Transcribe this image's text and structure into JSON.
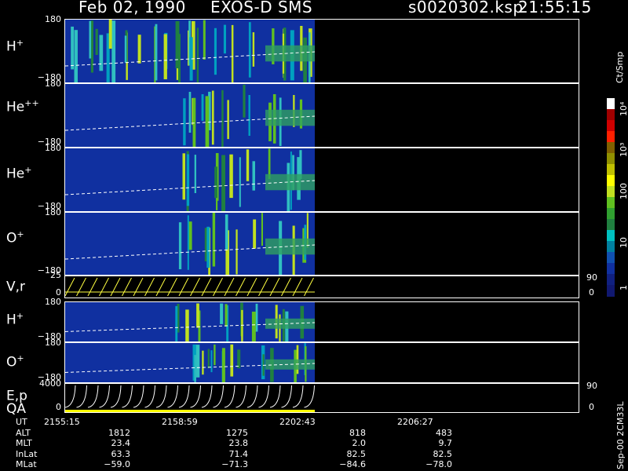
{
  "header": {
    "date": "Feb 02, 1990",
    "instrument": "EXOS-D SMS",
    "file": "s0020302.ksp",
    "time": "21:55:15"
  },
  "colors": {
    "background": "#000000",
    "spectrogram_base": "#1030a0",
    "trace": "#ffffff",
    "vr_trace": "#ffff40",
    "qa_bar": "#ffff00"
  },
  "panels": [
    {
      "label_base": "H",
      "label_sup": "+",
      "tick_top": "180",
      "tick_bottom": "−180"
    },
    {
      "label_base": "He",
      "label_sup": "++",
      "tick_top": "180",
      "tick_bottom": "−180"
    },
    {
      "label_base": "He",
      "label_sup": "+",
      "tick_top": "180",
      "tick_bottom": "−180"
    },
    {
      "label_base": "O",
      "label_sup": "+",
      "tick_top": "180",
      "tick_bottom": "−180"
    },
    {
      "label_base": "V,r",
      "label_sup": "",
      "tick_top": "25",
      "tick_bottom": "0",
      "rtick_top": "90",
      "rtick_bottom": "0"
    },
    {
      "label_base": "H",
      "label_sup": "+",
      "tick_top": "180",
      "tick_bottom": "−180"
    },
    {
      "label_base": "O",
      "label_sup": "+",
      "tick_top": "180",
      "tick_bottom": "−180"
    },
    {
      "label_base": "E,p",
      "label_sup": "",
      "label2": "QA",
      "tick_top": "4000",
      "tick_bottom": "0",
      "rtick_top": "90",
      "rtick_bottom": "0"
    }
  ],
  "colorbar": {
    "unit": "Ct/Smp",
    "labels": [
      "10⁴",
      "10³",
      "100",
      "10",
      "1"
    ],
    "swatches": [
      "#ffffff",
      "#a00000",
      "#d00000",
      "#ff2000",
      "#806000",
      "#909000",
      "#c0c000",
      "#ffff00",
      "#c0e020",
      "#60c020",
      "#30a030",
      "#208040",
      "#00c0c0",
      "#0080a0",
      "#1050b0",
      "#1030a0",
      "#102080",
      "#101870"
    ]
  },
  "footer_note": "Sep-00 2CM33L",
  "orbit_table": {
    "rows": [
      {
        "name": "UT",
        "values": [
          "2155:15",
          "2158:59",
          "2202:43",
          "2206:27"
        ]
      },
      {
        "name": "ALT",
        "values": [
          "1812",
          "1275",
          "818",
          "483"
        ]
      },
      {
        "name": "MLT",
        "values": [
          "23.4",
          "23.8",
          "2.0",
          "9.7"
        ]
      },
      {
        "name": "InLat",
        "values": [
          "63.3",
          "71.4",
          "82.5",
          "82.5"
        ]
      },
      {
        "name": "MLat",
        "values": [
          "−59.0",
          "−71.3",
          "−84.6",
          "−78.0"
        ]
      }
    ]
  }
}
